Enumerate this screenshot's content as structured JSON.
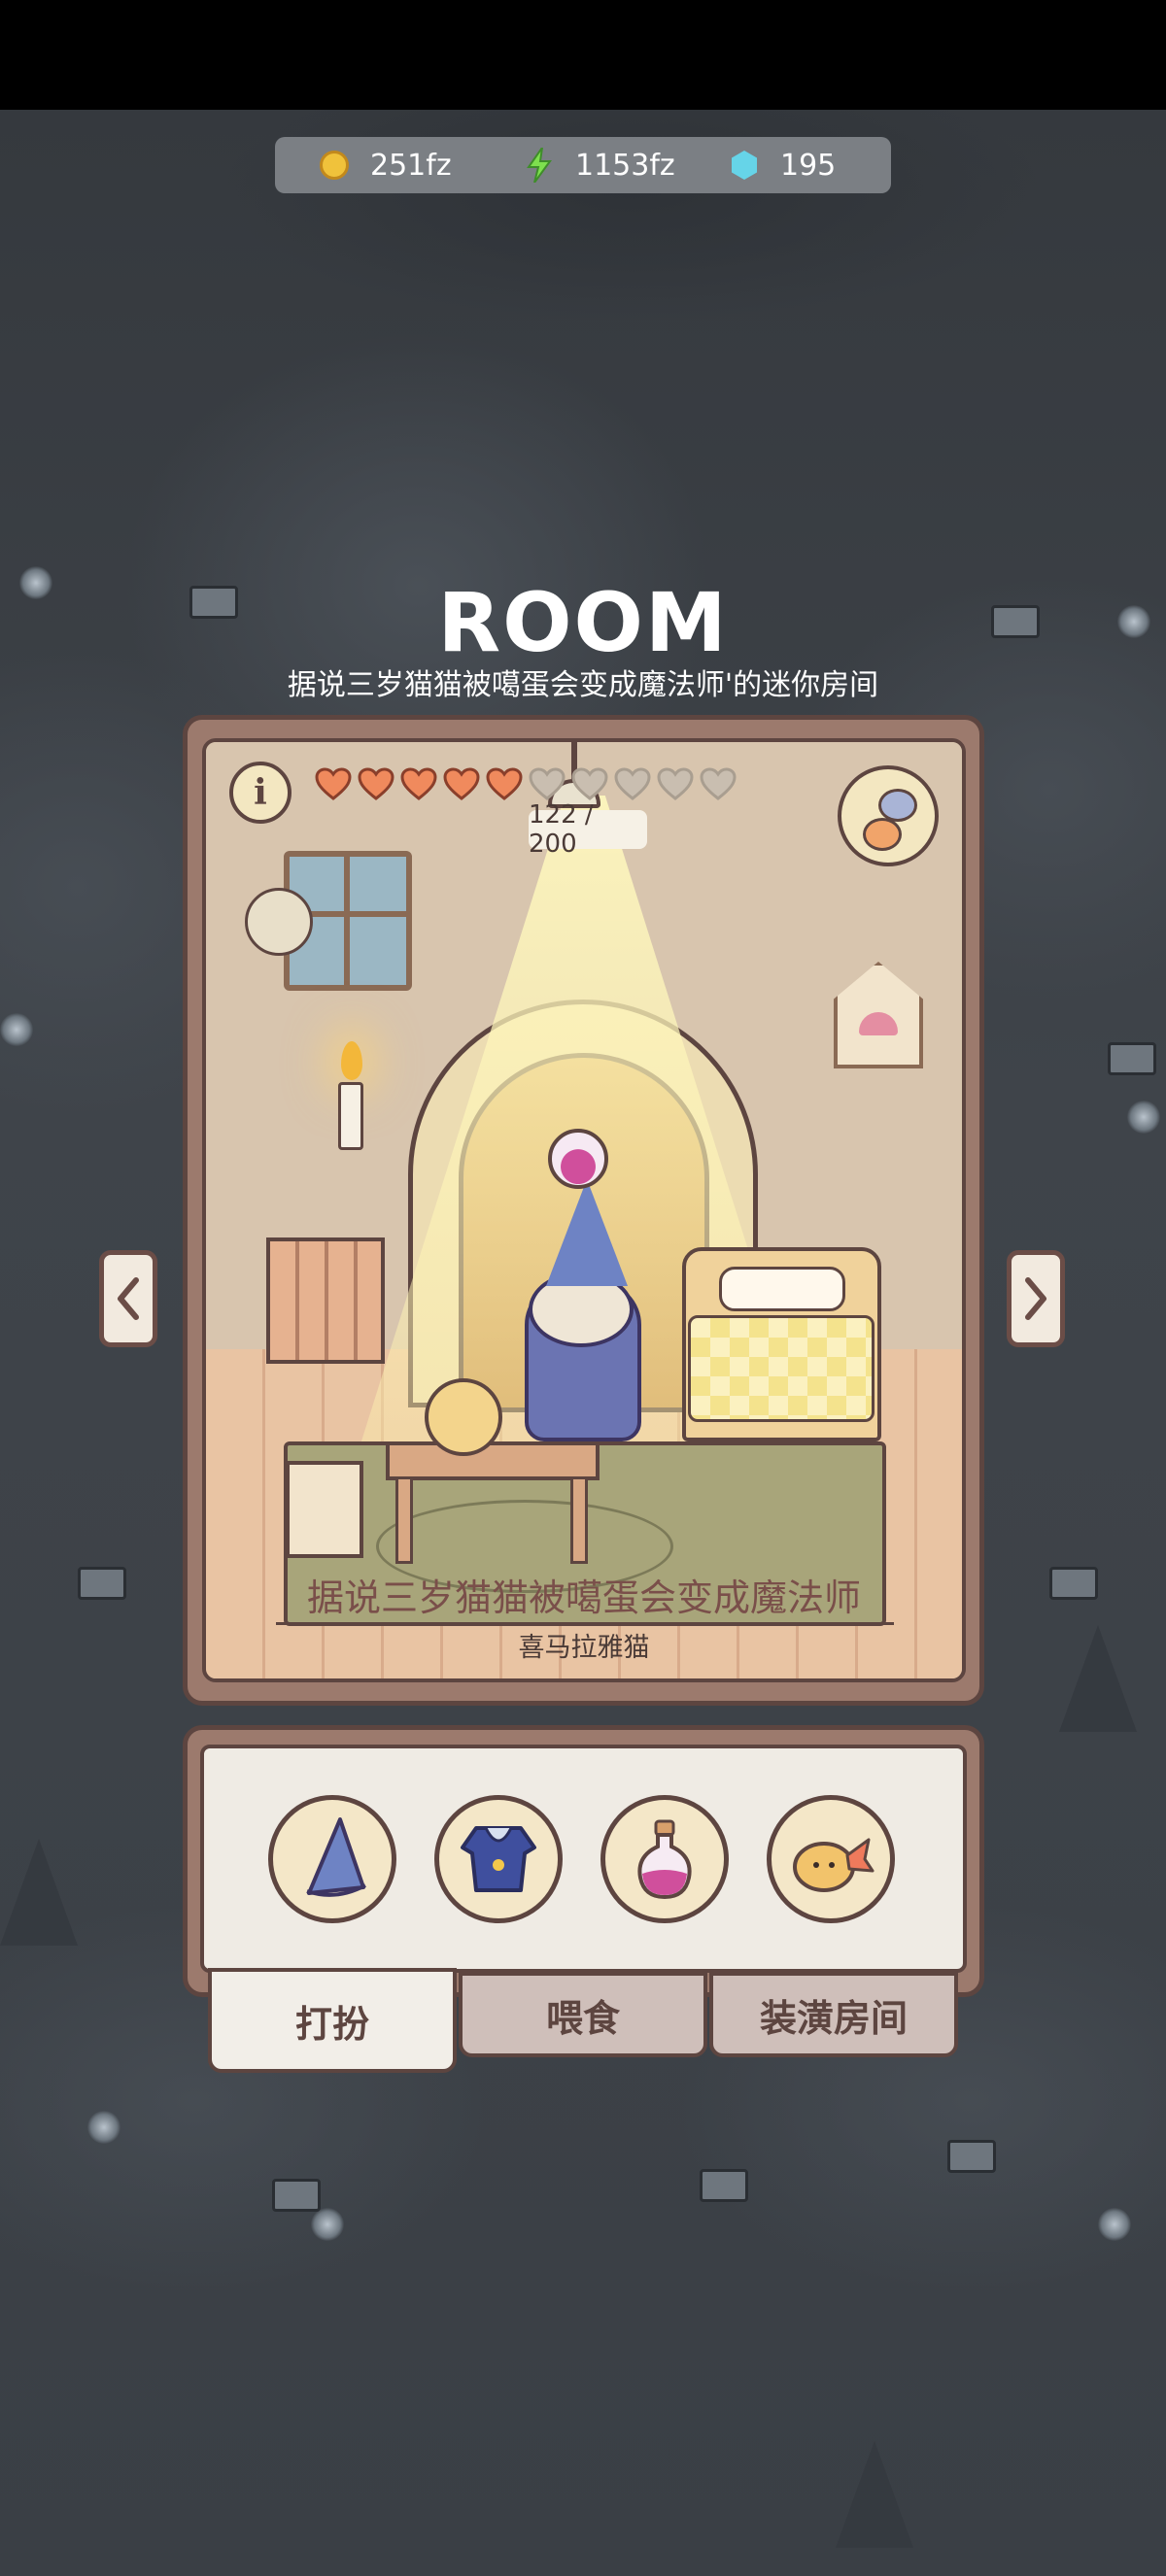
{
  "currency": {
    "coins": "251fz",
    "energy": "1153fz",
    "gems": "195"
  },
  "header": {
    "title": "ROOM",
    "subtitle": "据说三岁猫猫被噶蛋会变成魔法师'的迷你房间"
  },
  "room": {
    "info_label": "i",
    "hearts_filled": 5,
    "hearts_total": 10,
    "hp_text": "122 / 200",
    "caption": "据说三岁猫猫被噶蛋会变成魔法师",
    "breed": "喜马拉雅猫"
  },
  "items": [
    {
      "icon": "wizard-hat-icon"
    },
    {
      "icon": "wizard-robe-icon"
    },
    {
      "icon": "potion-icon"
    },
    {
      "icon": "fried-shrimp-icon"
    }
  ],
  "tabs": [
    {
      "label": "打扮",
      "active": true
    },
    {
      "label": "喂食",
      "active": false
    },
    {
      "label": "装潢房间",
      "active": false
    }
  ],
  "colors": {
    "heart_filled": "#f08a5d",
    "heart_empty": "#c9beb0",
    "frame": "#9c7a6d",
    "outline": "#5d4540"
  }
}
